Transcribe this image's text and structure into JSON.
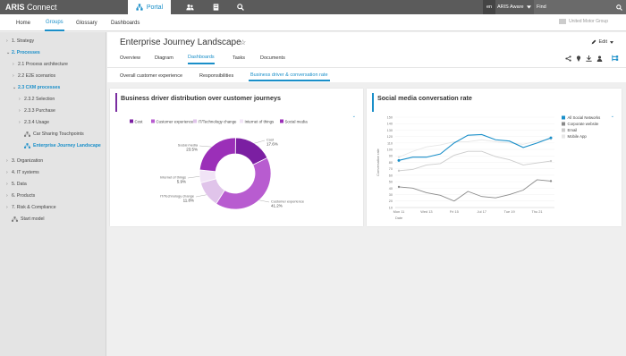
{
  "app": {
    "brand_bold": "ARIS",
    "brand_rest": " Connect",
    "portal_tab": "Portal"
  },
  "topbar": {
    "lang": "en",
    "database": "ARIS Aware",
    "find_label": "Find"
  },
  "nav": {
    "items": [
      "Home",
      "Groups",
      "Glossary",
      "Dashboards"
    ],
    "active": "Groups",
    "org_logo_text": "United Motor Group"
  },
  "sidebar": {
    "items": [
      {
        "label": "1. Strategy",
        "state": "collapsed"
      },
      {
        "label": "2. Processes",
        "state": "expanded"
      },
      {
        "label": "2.1 Process architecture",
        "state": "collapsed"
      },
      {
        "label": "2.2 E2E scenarios",
        "state": "collapsed"
      },
      {
        "label": "2.3 CXM processes",
        "state": "expanded"
      },
      {
        "label": "2.3.2 Selection",
        "state": "collapsed"
      },
      {
        "label": "2.3.3 Purchase",
        "state": "collapsed"
      },
      {
        "label": "2.3.4 Usage",
        "state": "collapsed"
      },
      {
        "label": "Car Sharing Touchpoints",
        "state": "model"
      },
      {
        "label": "Enterprise Journey Landscape",
        "state": "selected"
      },
      {
        "label": "3. Organization",
        "state": "collapsed"
      },
      {
        "label": "4. IT systems",
        "state": "collapsed"
      },
      {
        "label": "5. Data",
        "state": "collapsed"
      },
      {
        "label": "6. Products",
        "state": "collapsed"
      },
      {
        "label": "7. Risk & Compliance",
        "state": "collapsed"
      },
      {
        "label": "Start model",
        "state": "model"
      }
    ]
  },
  "page": {
    "title": "Enterprise Journey Landscape",
    "edit_label": "Edit",
    "tabs": [
      "Overview",
      "Diagram",
      "Dashboards",
      "Tasks",
      "Documents"
    ],
    "active_tab": "Dashboards",
    "subtabs": [
      "Overall customer experience",
      "Responsibilities",
      "Business driver & conversation rate"
    ],
    "active_subtab": "Business driver & conversation rate"
  },
  "colors": {
    "accent": "#1a8fc9",
    "purple_bar": "#7a2da0",
    "blue_bar": "#1a8fc9"
  },
  "chart_data": [
    {
      "type": "pie",
      "title": "Business driver distribution over customer journeys",
      "legend_position": "top",
      "categories": [
        "Cost",
        "Customer experience",
        "IT/Technology change",
        "Internet of things",
        "Social media"
      ],
      "values": [
        17.6,
        41.2,
        11.8,
        5.9,
        23.5
      ],
      "labels": [
        {
          "name": "Cost",
          "value": "17.6%"
        },
        {
          "name": "Customer experience",
          "value": "41.2%"
        },
        {
          "name": "IT/Technology change",
          "value": "11.8%"
        },
        {
          "name": "Internet of things",
          "value": "5.9%"
        },
        {
          "name": "Social media",
          "value": "23.5%"
        }
      ],
      "colors": [
        "#7b1fa2",
        "#b85cd0",
        "#e0c4ea",
        "#f1e4f6",
        "#9b2fb8"
      ]
    },
    {
      "type": "line",
      "title": "Social media conversation rate",
      "xlabel": "Date",
      "ylabel": "Conversation rate",
      "legend_position": "right",
      "x_ticks": [
        "Mon 11",
        "Wed 13",
        "Fri 15",
        "Jul 17",
        "Tue 19",
        "Thu 21"
      ],
      "y_ticks": [
        10,
        20,
        30,
        40,
        50,
        60,
        70,
        80,
        90,
        100,
        110,
        120,
        130,
        140,
        150
      ],
      "ylim": [
        10,
        150
      ],
      "x": [
        "Mon 11",
        "Tue 12",
        "Wed 13",
        "Thu 14",
        "Fri 15",
        "Sat 16",
        "Jul 17",
        "Mon 18",
        "Tue 19",
        "Wed 20",
        "Thu 21",
        "Fri 22"
      ],
      "series": [
        {
          "name": "All Social Networks",
          "color": "#1a8fc9",
          "values": [
            83,
            88,
            88,
            93,
            110,
            122,
            123,
            115,
            113,
            103,
            110,
            118
          ]
        },
        {
          "name": "Corporate website",
          "color": "#8a8a8a",
          "values": [
            42,
            40,
            33,
            29,
            20,
            35,
            27,
            25,
            30,
            37,
            53,
            51
          ]
        },
        {
          "name": "Email",
          "color": "#cccccc",
          "values": [
            67,
            69,
            76,
            78,
            91,
            97,
            97,
            89,
            84,
            76,
            79,
            82
          ]
        },
        {
          "name": "Mobile App",
          "color": "#e6e6e6",
          "values": [
            88,
            97,
            104,
            107,
            112,
            112,
            115,
            112,
            110,
            108,
            113,
            116
          ]
        }
      ]
    }
  ]
}
